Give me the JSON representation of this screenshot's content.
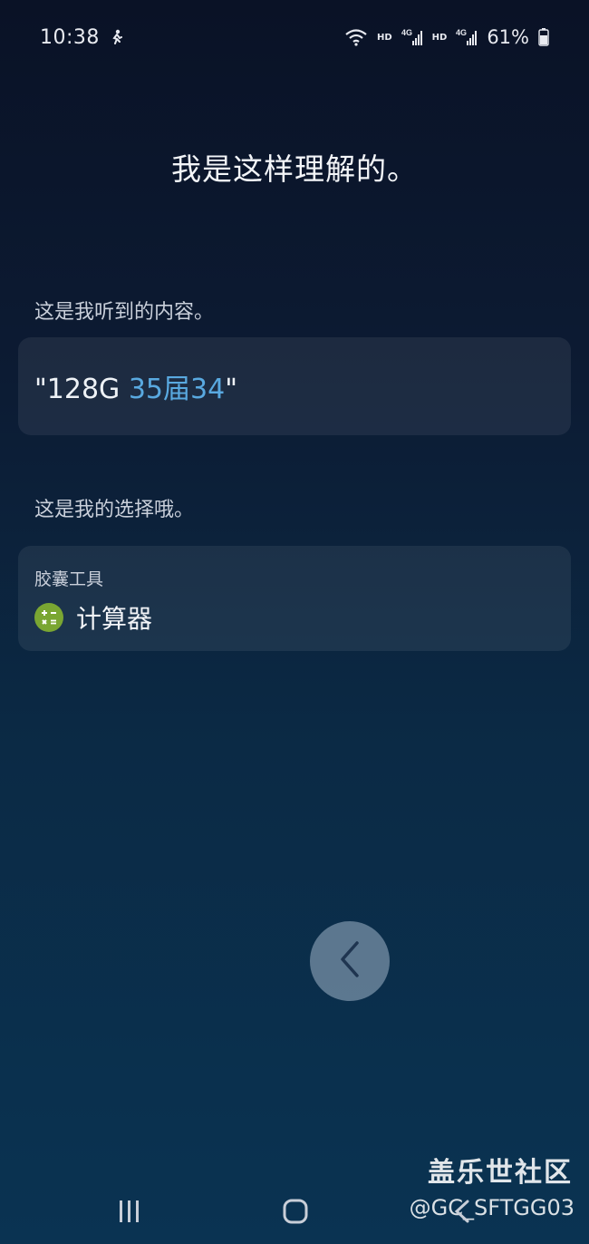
{
  "status_bar": {
    "time": "10:38",
    "hd1": "HD",
    "net1": "4G",
    "hd2": "HD",
    "net2": "4G",
    "battery": "61%"
  },
  "headline": "我是这样理解的。",
  "heard_section": {
    "label": "这是我听到的内容。",
    "quote_open": "\"128G ",
    "highlight": "35届34",
    "quote_close": "\""
  },
  "choice_section": {
    "label": "这是我的选择哦。",
    "category": "胶囊工具",
    "app_name": "计算器"
  },
  "watermark": {
    "title": "盖乐世社区",
    "handle": "@GC_SFTGG03"
  },
  "colors": {
    "accent": "#59a9e0",
    "calc_icon": "#7aa632"
  },
  "icons": [
    "runner-icon",
    "wifi-icon",
    "signal-icon",
    "battery-icon",
    "calculator-icon",
    "chevron-left-icon",
    "recent-apps-icon",
    "home-icon",
    "back-icon"
  ]
}
